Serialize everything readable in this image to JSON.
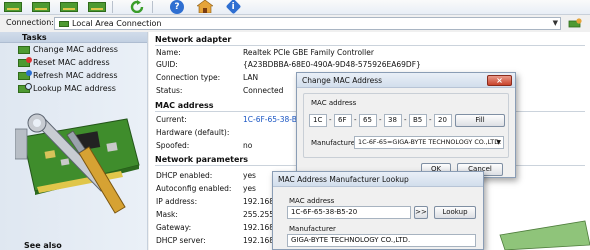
{
  "toolbar": {
    "buttons": [
      {
        "icon": "network-card-icon"
      },
      {
        "icon": "network-card-icon"
      },
      {
        "icon": "network-card-icon"
      },
      {
        "icon": "network-card-icon"
      },
      {
        "icon": "refresh-icon"
      },
      {
        "icon": "help-icon",
        "glyph": "?"
      },
      {
        "icon": "home-icon"
      },
      {
        "icon": "info-icon",
        "glyph": "i"
      }
    ]
  },
  "connection": {
    "label": "Connection:",
    "selected": "Local Area Connection"
  },
  "tasks": {
    "title": "Tasks",
    "items": [
      {
        "label": "Change MAC address"
      },
      {
        "label": "Reset MAC address"
      },
      {
        "label": "Refresh MAC address"
      },
      {
        "label": "Lookup MAC address"
      }
    ],
    "see_also": "See also"
  },
  "network_adapter": {
    "title": "Network adapter",
    "rows": [
      {
        "label": "Name:",
        "value": "Realtek PCIe GBE Family Controller"
      },
      {
        "label": "GUID:",
        "value": "{A23BDBBA-68E0-490A-9D48-575926EA69DF}"
      },
      {
        "label": "Connection type:",
        "value": "LAN"
      },
      {
        "label": "Status:",
        "value": "Connected"
      }
    ]
  },
  "mac_address": {
    "title": "MAC address",
    "rows": [
      {
        "label": "Current:",
        "value": "1C-6F-65-38-B5"
      },
      {
        "label": "Hardware (default):",
        "value": ""
      },
      {
        "label": "Spoofed:",
        "value": "no"
      }
    ]
  },
  "network_parameters": {
    "title": "Network parameters",
    "rows": [
      {
        "label": "DHCP enabled:",
        "value": "yes"
      },
      {
        "label": "Autoconfig enabled:",
        "value": "yes"
      },
      {
        "label": "IP address:",
        "value": "192.168"
      },
      {
        "label": "Mask:",
        "value": "255.255"
      },
      {
        "label": "Gateway:",
        "value": "192.168"
      },
      {
        "label": "DHCP server:",
        "value": "192.168"
      }
    ]
  },
  "change_dialog": {
    "title": "Change MAC Address",
    "close": "×",
    "mac_label": "MAC address",
    "octets": [
      "1C",
      "6F",
      "65",
      "38",
      "B5",
      "20"
    ],
    "fill_button": "Fill",
    "manufacturer_label": "Manufacturer",
    "manufacturer_value": "1C-6F-65=GIGA-BYTE TECHNOLOGY CO.,LTD.",
    "ok_button": "OK",
    "cancel_button": "Cancel"
  },
  "lookup_dialog": {
    "title": "MAC Address Manufacturer Lookup",
    "mac_label": "MAC address",
    "mac_value": "1C-6F-65-38-B5-20",
    "arrow_button": ">>",
    "lookup_button": "Lookup",
    "manufacturer_label": "Manufacturer",
    "manufacturer_value": "GIGA-BYTE TECHNOLOGY CO.,LTD."
  },
  "colors": {
    "link": "#1a56c4",
    "accent": "#4e9a32"
  }
}
